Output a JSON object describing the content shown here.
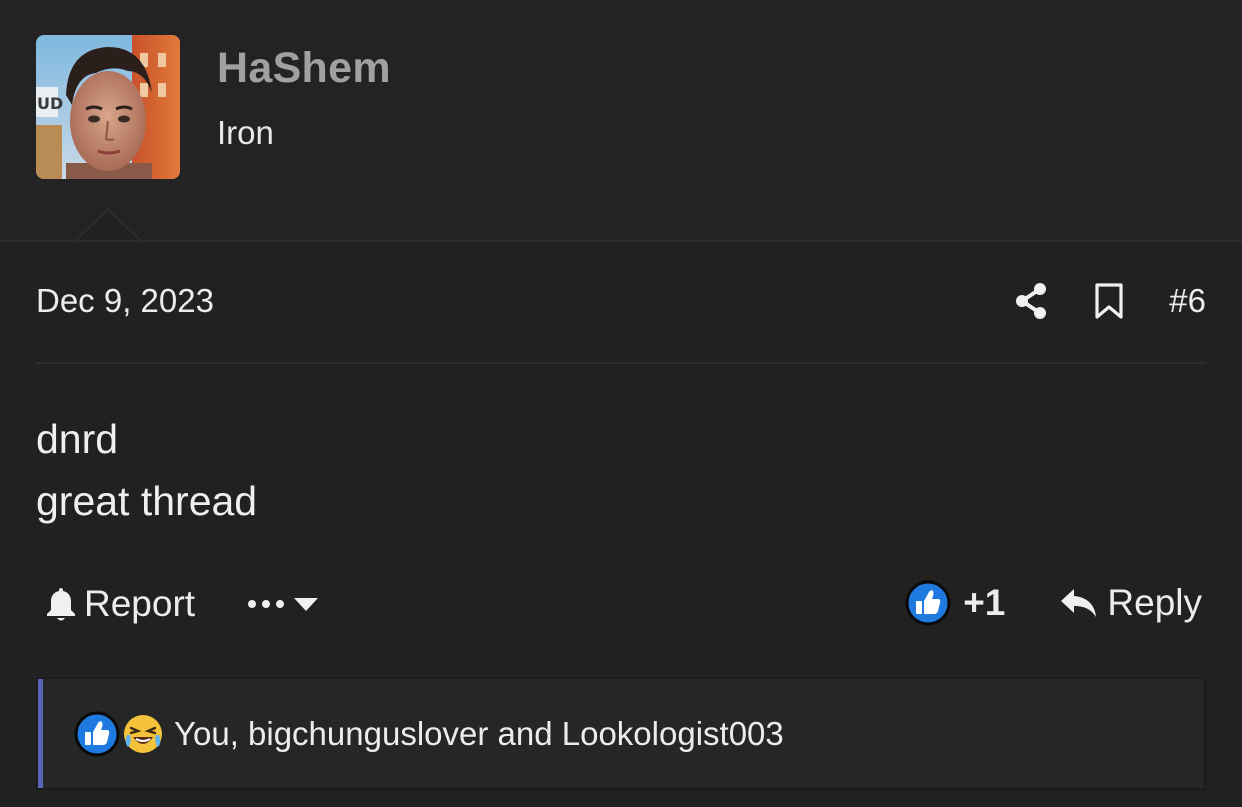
{
  "user": {
    "name": "HaShem",
    "title": "Iron",
    "avatar_icon": "user-avatar-photo"
  },
  "post": {
    "date": "Dec 9, 2023",
    "number": "#6",
    "body_lines": [
      "dnrd",
      "great thread"
    ]
  },
  "actions": {
    "report_label": "Report",
    "like_count": "+1",
    "reply_label": "Reply",
    "icons": [
      "bell-icon",
      "more-icon",
      "caret-down-icon",
      "like-icon",
      "reply-icon",
      "share-icon",
      "bookmark-icon"
    ]
  },
  "reactions": {
    "text": "You, bigchunguslover and Lookologist003",
    "icons": [
      "like-reaction-icon",
      "crying-laughing-reaction-icon"
    ]
  },
  "colors": {
    "background": "#212121",
    "accent": "#5a63b8",
    "like_blue": "#1f7ae0",
    "username": "#a0a0a0"
  }
}
